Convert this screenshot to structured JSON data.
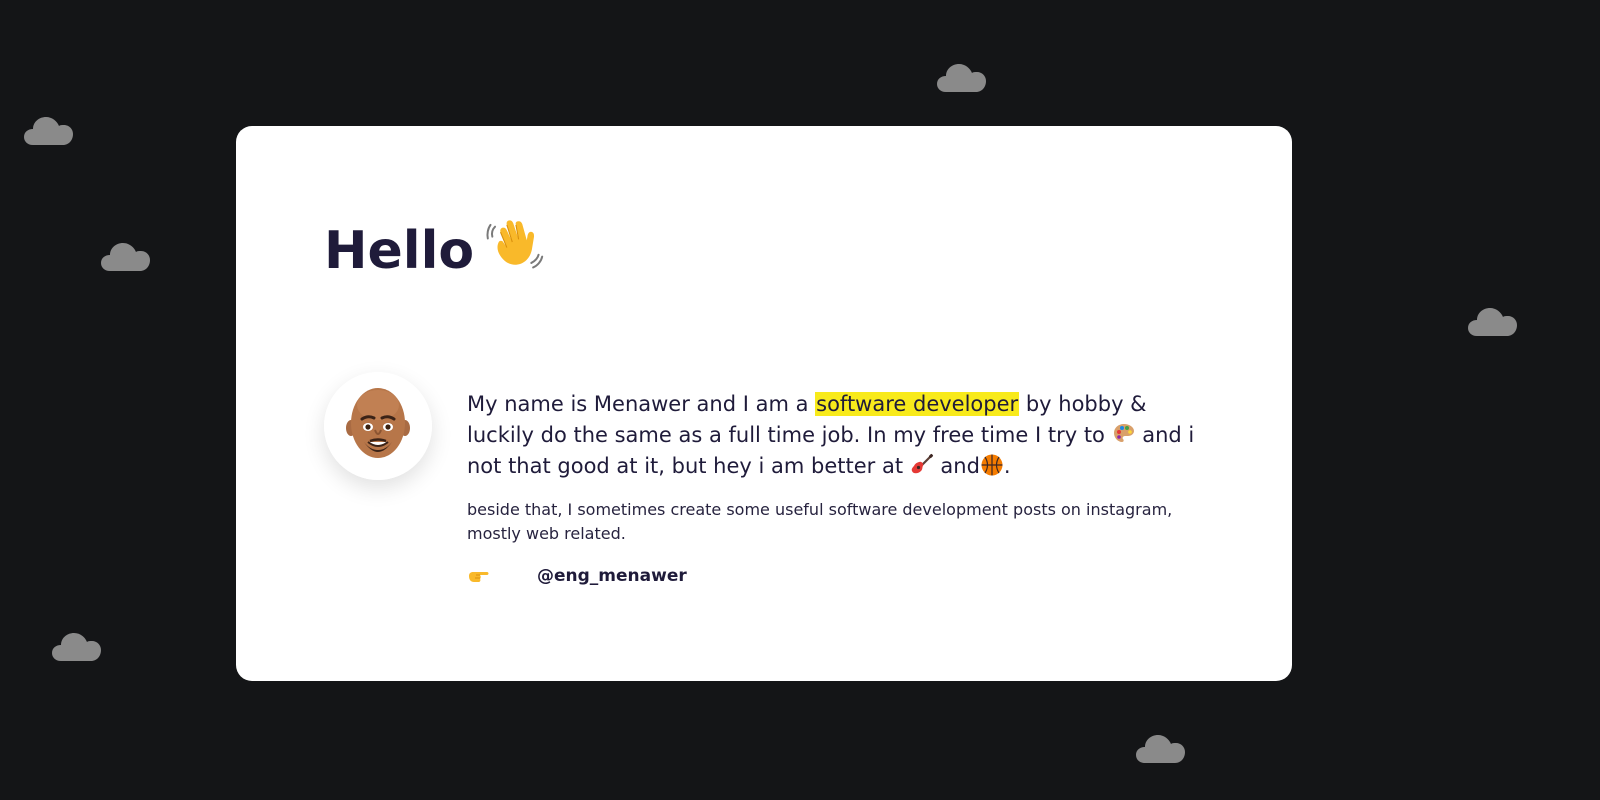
{
  "hero": {
    "title": "Hello"
  },
  "about": {
    "intro_1": "My name is Menawer and I am a ",
    "highlight": "software developer",
    "intro_2": " by hobby & luckily do the same as a full time job. In my free time I try to ",
    "intro_3": " and i not that good at it, but hey i am better at ",
    "intro_4": " and",
    "intro_5": ".",
    "secondary": "beside that, I sometimes create some useful software development posts on instagram, mostly web related.",
    "handle": "@eng_menawer"
  },
  "icons": {
    "wave": "waving-hand-icon",
    "paint": "artist-palette-icon",
    "guitar": "guitar-icon",
    "basketball": "basketball-icon",
    "point": "pointing-right-icon",
    "avatar": "memoji-avatar",
    "cloud": "cloud-icon"
  },
  "colors": {
    "background": "#141517",
    "card": "#ffffff",
    "text": "#1f1b3a",
    "highlight": "#f8ea1b",
    "cloud": "#8b8b8b"
  }
}
